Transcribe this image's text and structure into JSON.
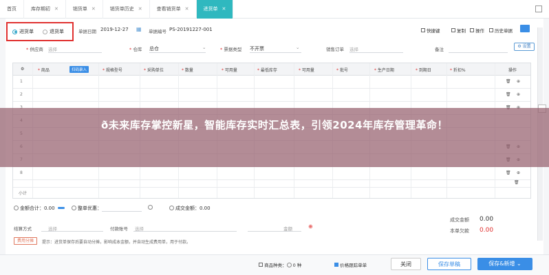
{
  "tabs": [
    {
      "label": "首页",
      "closable": false
    },
    {
      "label": "库存期初",
      "closable": true
    },
    {
      "label": "销货单",
      "closable": true
    },
    {
      "label": "销货单历史",
      "closable": true
    },
    {
      "label": "查看销货单",
      "closable": true
    },
    {
      "label": "进货单",
      "closable": true,
      "active": true
    }
  ],
  "doc_type": {
    "option1": "进货单",
    "option2": "退货单"
  },
  "header": {
    "date_label": "单据日期",
    "date_value": "2019-12-27",
    "docno_label": "单据编号",
    "docno_value": "PS-20191227-001"
  },
  "toolbar": {
    "quick_key": "快捷键",
    "copy": "复制",
    "actions": "操作",
    "history": "历史单据"
  },
  "form": {
    "supplier_label": "供应商",
    "supplier_placeholder": "选择",
    "warehouse_label": "仓库",
    "warehouse_value": "总仓",
    "invoice_label": "票据类型",
    "invoice_value": "不开票",
    "sales_order_label": "销售订单",
    "sales_order_placeholder": "选择",
    "remark_label": "备注",
    "settings_button": "设置"
  },
  "grid": {
    "columns": [
      "商品",
      "规格型号",
      "采购单位",
      "数量",
      "可用量",
      "最低库存",
      "可用量",
      "批号",
      "生产日期",
      "到期日",
      "折扣%",
      "操作"
    ],
    "tag": "扫码录入",
    "rows": [
      "1",
      "2",
      "3",
      "4",
      "5",
      "6",
      "7",
      "8"
    ],
    "subtotal_label": "小计"
  },
  "banner": {
    "title": "ð未来库存掌控新星，智能库存实时汇总表，引领2024年库存管理革命！"
  },
  "summary": {
    "amount_label": "金额合计：",
    "amount_value": "0.00",
    "whole_discount_label": "整单优惠：",
    "deal_amount_label": "成交金额：",
    "deal_amount_value": "0.00",
    "settle_label": "结算方式",
    "settle_placeholder": "选择",
    "payment_account_label": "付款账号",
    "payment_account_placeholder": "选择",
    "amount_field_label": "金额"
  },
  "fee_button": "费用分摊",
  "hint": "提示：进货单保存后要自动分摊，影响成本金额，并自动生成费用单，用于付款。",
  "totals": {
    "deal_label": "成交金额",
    "deal_value": "0.00",
    "owed_label": "本单欠款",
    "owed_value": "0.00"
  },
  "footer": {
    "product_count_label": "商品种类：",
    "product_count_value": "0",
    "unit_label": "种",
    "price_tracking_label": "价格跟踪单单",
    "back_button": "关闭",
    "save_new_button": "保存单稿",
    "save_add_button": "保存&新增"
  },
  "colors": {
    "accent": "#2fb8bf",
    "primary_button": "#3a8ee6",
    "highlight_red": "#e0302f",
    "amount_red": "#e0302f"
  }
}
